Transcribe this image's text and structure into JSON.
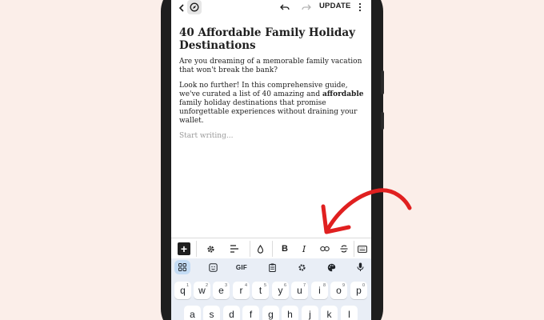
{
  "toolbar": {
    "update_label": "UPDATE",
    "icons": [
      "chevron-left-icon",
      "compass-icon",
      "undo-icon",
      "redo-icon",
      "more-vertical-icon"
    ]
  },
  "post": {
    "title": "40 Affordable Family Holiday Destinations",
    "para1": "Are you dreaming of a memorable family vacation that won't break the bank?",
    "para2_before": "Look no further! In this comprehensive guide, we've curated a list of 40 amazing and ",
    "para2_bold": "affordable",
    "para2_after": " family holiday destinations that promise unforgettable experiences without draining your wallet.",
    "placeholder": "Start writing..."
  },
  "format_toolbar": {
    "bold": "B",
    "italic": "I"
  },
  "keyboard": {
    "gif_label": "GIF",
    "row1": [
      "q",
      "w",
      "e",
      "r",
      "t",
      "y",
      "u",
      "i",
      "o",
      "p"
    ],
    "row1_numbers": [
      "1",
      "2",
      "3",
      "4",
      "5",
      "6",
      "7",
      "8",
      "9",
      "0"
    ],
    "row2": [
      "a",
      "s",
      "d",
      "f",
      "g",
      "h",
      "j",
      "k",
      "l"
    ]
  },
  "colors": {
    "background": "#fbeee9",
    "arrow": "#e02020",
    "keyboard_bg": "#e9eef6"
  }
}
